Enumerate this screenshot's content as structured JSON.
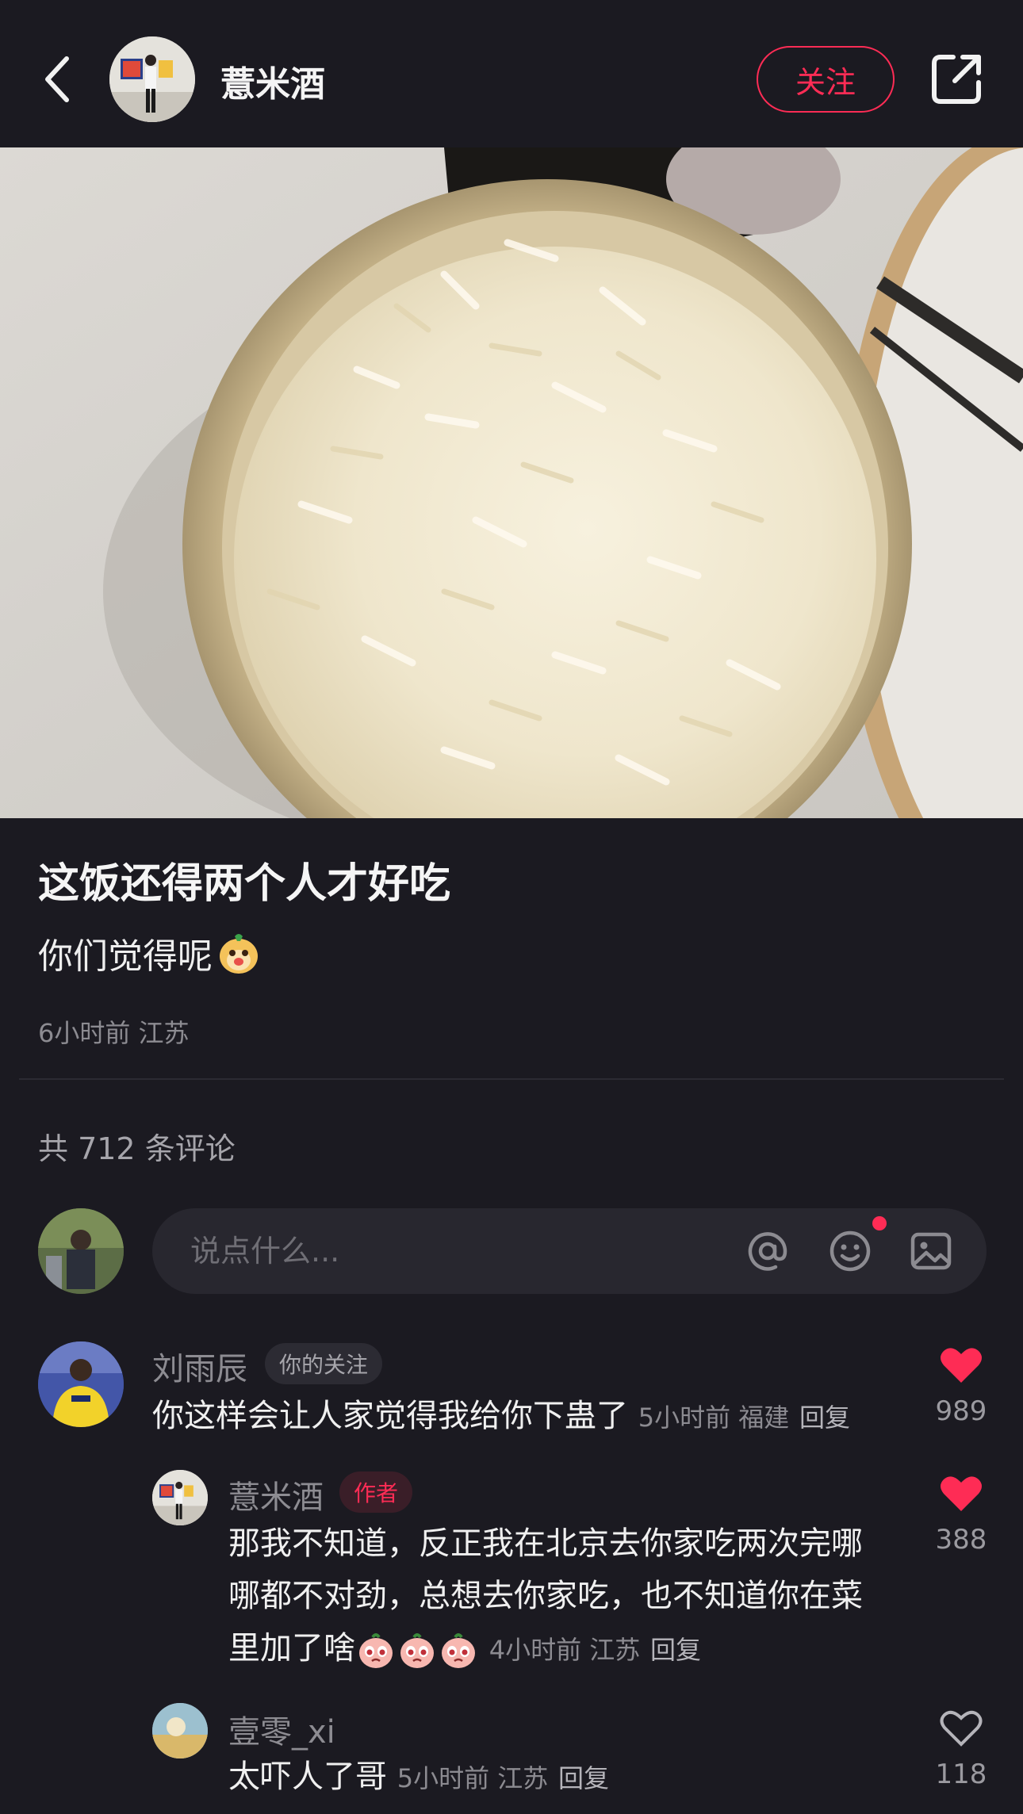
{
  "header": {
    "author_name": "薏米酒",
    "follow_label": "关注"
  },
  "post": {
    "title": "这饭还得两个人才好吃",
    "body": "你们觉得呢",
    "meta": "6小时前 江苏"
  },
  "comments_header": {
    "count_text": "共 712 条评论"
  },
  "comment_input": {
    "placeholder": "说点什么..."
  },
  "comments": [
    {
      "author": "刘雨辰",
      "tag": "你的关注",
      "text": "你这样会让人家觉得我给你下蛊了",
      "meta": "5小时前 福建",
      "reply": "回复",
      "likes": "989",
      "liked": true
    },
    {
      "author": "薏米酒",
      "tag": "作者",
      "line1": "那我不知道，反正我在北京去你家吃两次完哪",
      "line2": "哪都不对劲，总想去你家吃，也不知道你在菜",
      "line3": "里加了啥",
      "meta": "4小时前 江苏",
      "reply": "回复",
      "likes": "388",
      "liked": true
    },
    {
      "author": "壹零_xi",
      "text": "太吓人了哥",
      "meta": "5小时前 江苏",
      "reply": "回复",
      "likes": "118",
      "liked": false
    }
  ],
  "colors": {
    "accent": "#fe2c55",
    "background": "#1b1a21"
  }
}
